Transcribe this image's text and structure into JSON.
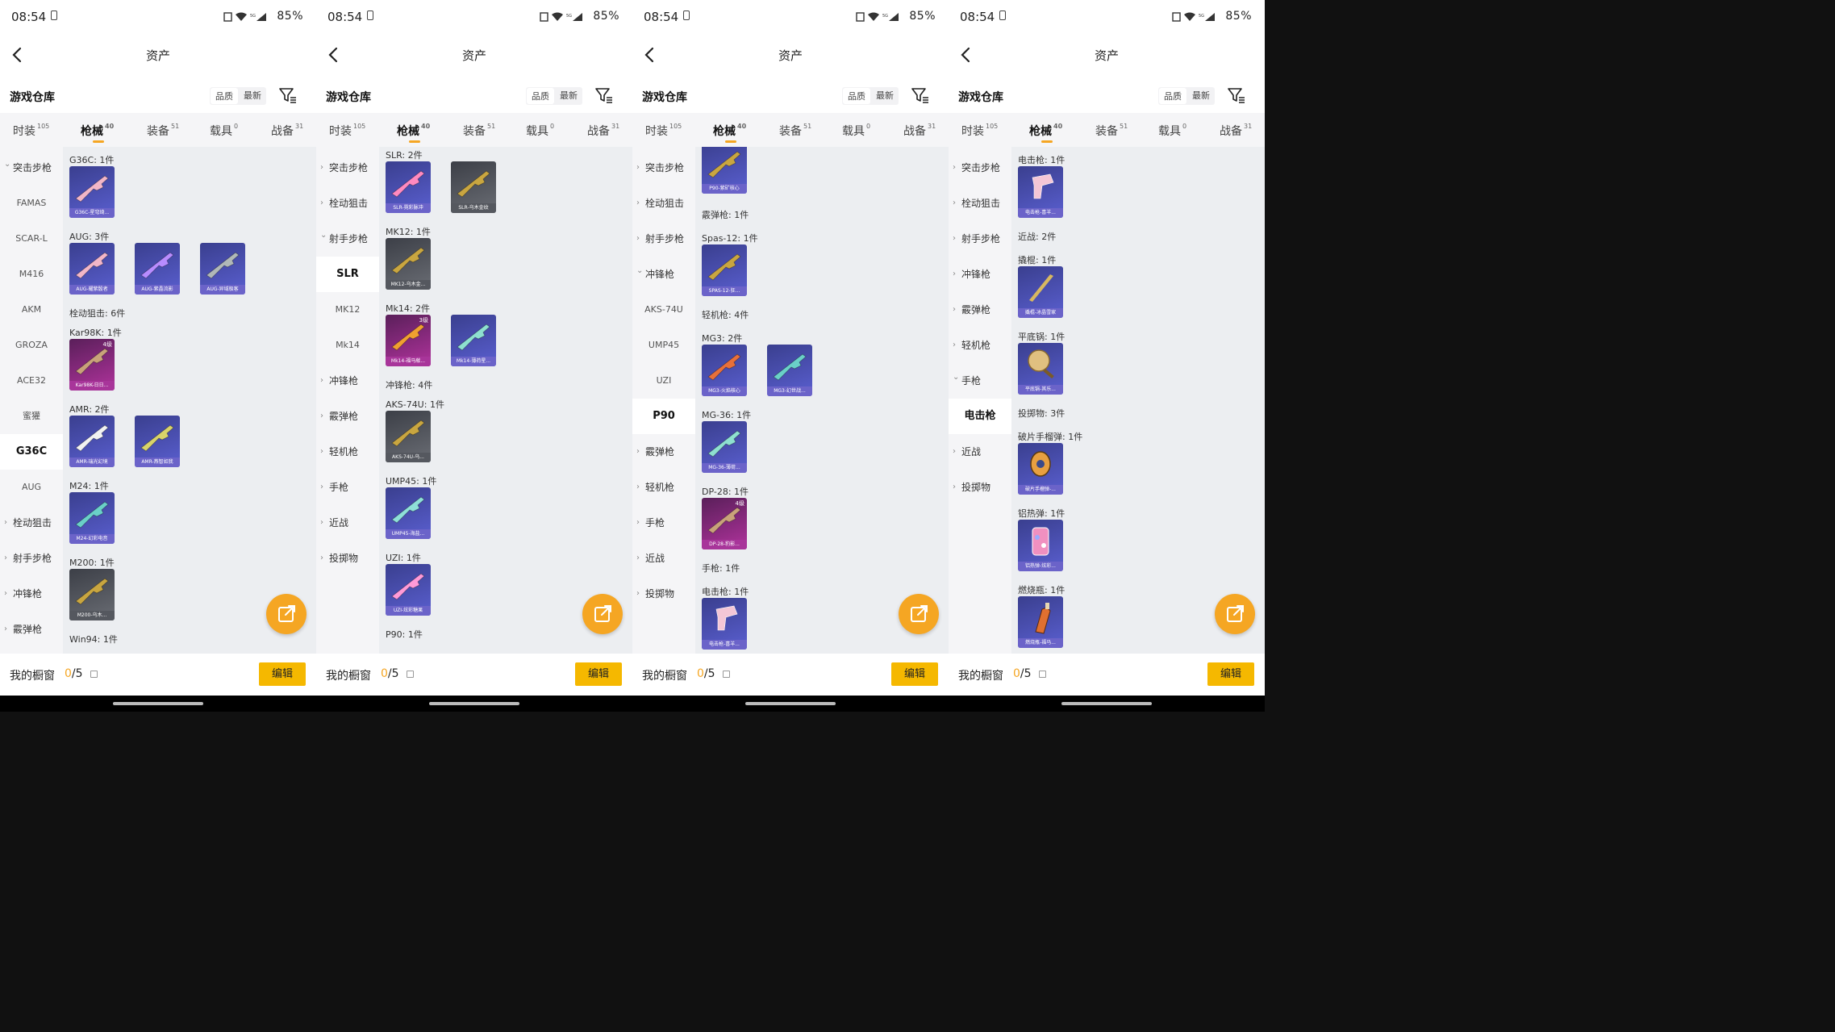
{
  "status": {
    "time": "08:54",
    "battery": "85%"
  },
  "header": {
    "title": "资产"
  },
  "warehouse": {
    "title": "游戏仓库",
    "sort_quality": "品质",
    "sort_latest": "最新"
  },
  "tabs": [
    {
      "label": "时装",
      "count": "105"
    },
    {
      "label": "枪械",
      "count": "40"
    },
    {
      "label": "装备",
      "count": "51"
    },
    {
      "label": "载具",
      "count": "0"
    },
    {
      "label": "战备",
      "count": "31"
    }
  ],
  "footer": {
    "label": "我的橱窗",
    "count_current": "0",
    "count_total": "/5",
    "edit": "编辑"
  },
  "colors": {
    "accent": "#f5a623",
    "edit_button": "#f5b800"
  },
  "panels": [
    {
      "sidebar": [
        {
          "label": "突击步枪",
          "type": "cat",
          "expanded": true
        },
        {
          "label": "FAMAS",
          "type": "sub"
        },
        {
          "label": "SCAR-L",
          "type": "sub"
        },
        {
          "label": "M416",
          "type": "sub"
        },
        {
          "label": "AKM",
          "type": "sub"
        },
        {
          "label": "GROZA",
          "type": "sub"
        },
        {
          "label": "ACE32",
          "type": "sub"
        },
        {
          "label": "蜜獾",
          "type": "sub"
        },
        {
          "label": "G36C",
          "type": "sub",
          "selected": true
        },
        {
          "label": "AUG",
          "type": "sub"
        },
        {
          "label": "栓动狙击",
          "type": "cat"
        },
        {
          "label": "射手步枪",
          "type": "cat"
        },
        {
          "label": "冲锋枪",
          "type": "cat"
        },
        {
          "label": "霰弹枪",
          "type": "cat"
        }
      ],
      "rows": [
        {
          "label": "G36C: 1件",
          "cards": [
            {
              "cap": "G36C-星穹绮...",
              "tone": "purple",
              "icon": "rifle-pink"
            }
          ]
        },
        {
          "label": "AUG: 3件",
          "cards": [
            {
              "cap": "AUG-耀紫骰者",
              "tone": "purple",
              "icon": "rifle-pink"
            },
            {
              "cap": "AUG-紫晶流影",
              "tone": "purple",
              "icon": "rifle-purple"
            },
            {
              "cap": "AUG-异域极客",
              "tone": "purple",
              "icon": "rifle-grey"
            }
          ]
        },
        {
          "label": "栓动狙击: 6件",
          "cards": []
        },
        {
          "label": "Kar98K: 1件",
          "cards": [
            {
              "cap": "Kar98K-日日...",
              "tone": "pink",
              "icon": "sniper",
              "badge": "4级"
            }
          ]
        },
        {
          "label": "AMR: 2件",
          "cards": [
            {
              "cap": "AMR-瑞光幻境",
              "tone": "purple",
              "icon": "sniper-white"
            },
            {
              "cap": "AMR-燕智如我",
              "tone": "purple",
              "icon": "sniper-yellow"
            }
          ]
        },
        {
          "label": "M24: 1件",
          "cards": [
            {
              "cap": "M24-幻彩电音",
              "tone": "purple",
              "icon": "sniper-teal"
            }
          ]
        },
        {
          "label": "M200: 1件",
          "cards": [
            {
              "cap": "M200-乌木...",
              "tone": "grey",
              "icon": "sniper-gold"
            }
          ]
        },
        {
          "label": "Win94: 1件",
          "cards": []
        }
      ]
    },
    {
      "sidebar": [
        {
          "label": "突击步枪",
          "type": "cat"
        },
        {
          "label": "栓动狙击",
          "type": "cat"
        },
        {
          "label": "射手步枪",
          "type": "cat",
          "expanded": true
        },
        {
          "label": "SLR",
          "type": "sub",
          "selected": true
        },
        {
          "label": "MK12",
          "type": "sub"
        },
        {
          "label": "Mk14",
          "type": "sub"
        },
        {
          "label": "冲锋枪",
          "type": "cat"
        },
        {
          "label": "霰弹枪",
          "type": "cat"
        },
        {
          "label": "轻机枪",
          "type": "cat"
        },
        {
          "label": "手枪",
          "type": "cat"
        },
        {
          "label": "近战",
          "type": "cat"
        },
        {
          "label": "投掷物",
          "type": "cat"
        }
      ],
      "rows": [
        {
          "label": "SLR: 2件",
          "cards": [
            {
              "cap": "SLR-霓彩脉冲",
              "tone": "purple",
              "icon": "sniper-pink"
            },
            {
              "cap": "SLR-乌木金纹",
              "tone": "grey",
              "icon": "sniper-gold"
            }
          ]
        },
        {
          "label": "MK12: 1件",
          "cards": [
            {
              "cap": "MK12-乌木金...",
              "tone": "grey",
              "icon": "sniper-gold"
            }
          ]
        },
        {
          "label": "Mk14: 2件",
          "cards": [
            {
              "cap": "Mk14-福马献...",
              "tone": "pink",
              "icon": "rifle-orange",
              "badge": "3级"
            },
            {
              "cap": "Mk14-薄荷星...",
              "tone": "purple",
              "icon": "rifle-teal"
            }
          ]
        },
        {
          "label": "冲锋枪: 4件",
          "cards": []
        },
        {
          "label": "AKS-74U: 1件",
          "cards": [
            {
              "cap": "AKS-74U-乌...",
              "tone": "grey",
              "icon": "smg-gold"
            }
          ]
        },
        {
          "label": "UMP45: 1件",
          "cards": [
            {
              "cap": "UMP45-海盐...",
              "tone": "purple",
              "icon": "smg-teal"
            }
          ]
        },
        {
          "label": "UZI: 1件",
          "cards": [
            {
              "cap": "UZI-炫彩糖果",
              "tone": "purple",
              "icon": "smg-pink"
            }
          ]
        },
        {
          "label": "P90: 1件",
          "cards": []
        }
      ]
    },
    {
      "sidebar": [
        {
          "label": "突击步枪",
          "type": "cat"
        },
        {
          "label": "栓动狙击",
          "type": "cat"
        },
        {
          "label": "射手步枪",
          "type": "cat"
        },
        {
          "label": "冲锋枪",
          "type": "cat",
          "expanded": true
        },
        {
          "label": "AKS-74U",
          "type": "sub"
        },
        {
          "label": "UMP45",
          "type": "sub"
        },
        {
          "label": "UZI",
          "type": "sub"
        },
        {
          "label": "P90",
          "type": "sub",
          "selected": true
        },
        {
          "label": "霰弹枪",
          "type": "cat"
        },
        {
          "label": "轻机枪",
          "type": "cat"
        },
        {
          "label": "手枪",
          "type": "cat"
        },
        {
          "label": "近战",
          "type": "cat"
        },
        {
          "label": "投掷物",
          "type": "cat"
        }
      ],
      "rows": [
        {
          "label": "",
          "cards": [
            {
              "cap": "P90-紫矿核心",
              "tone": "purple",
              "icon": "smg-gold"
            }
          ]
        },
        {
          "label": "霰弹枪: 1件",
          "cards": []
        },
        {
          "label": "Spas-12: 1件",
          "cards": [
            {
              "cap": "SPAS-12-狂...",
              "tone": "purple",
              "icon": "sniper-gold"
            }
          ]
        },
        {
          "label": "轻机枪: 4件",
          "cards": []
        },
        {
          "label": "MG3: 2件",
          "cards": [
            {
              "cap": "MG3-火焰核心",
              "tone": "purple",
              "icon": "sniper-orange"
            },
            {
              "cap": "MG3-幻世战...",
              "tone": "purple",
              "icon": "sniper-teal"
            }
          ]
        },
        {
          "label": "MG-36: 1件",
          "cards": [
            {
              "cap": "MG-36-薄荷...",
              "tone": "purple",
              "icon": "rifle-teal"
            }
          ]
        },
        {
          "label": "DP-28: 1件",
          "cards": [
            {
              "cap": "DP-28-豹影...",
              "tone": "pink",
              "icon": "sniper",
              "badge": "4级"
            }
          ]
        },
        {
          "label": "手枪: 1件",
          "cards": []
        },
        {
          "label": "电击枪: 1件",
          "cards": [
            {
              "cap": "电击枪-喜羊...",
              "tone": "purple",
              "icon": "taser"
            }
          ]
        }
      ]
    },
    {
      "sidebar": [
        {
          "label": "突击步枪",
          "type": "cat"
        },
        {
          "label": "栓动狙击",
          "type": "cat"
        },
        {
          "label": "射手步枪",
          "type": "cat"
        },
        {
          "label": "冲锋枪",
          "type": "cat"
        },
        {
          "label": "霰弹枪",
          "type": "cat"
        },
        {
          "label": "轻机枪",
          "type": "cat"
        },
        {
          "label": "手枪",
          "type": "cat",
          "expanded": true
        },
        {
          "label": "电击枪",
          "type": "sub",
          "selected": true
        },
        {
          "label": "近战",
          "type": "cat"
        },
        {
          "label": "投掷物",
          "type": "cat"
        }
      ],
      "rows": [
        {
          "label": "电击枪: 1件",
          "cards": [
            {
              "cap": "电击枪-喜羊...",
              "tone": "purple",
              "icon": "taser"
            }
          ]
        },
        {
          "label": "近战: 2件",
          "cards": []
        },
        {
          "label": "撬棍: 1件",
          "cards": [
            {
              "cap": "撬棍-冰晶雪家",
              "tone": "purple",
              "icon": "crowbar"
            }
          ]
        },
        {
          "label": "平底锅: 1件",
          "cards": [
            {
              "cap": "平底锅-其乐...",
              "tone": "purple",
              "icon": "pan"
            }
          ]
        },
        {
          "label": "投掷物: 3件",
          "cards": []
        },
        {
          "label": "破片手榴弹: 1件",
          "cards": [
            {
              "cap": "破片手榴弹-...",
              "tone": "purple",
              "icon": "grenade"
            }
          ]
        },
        {
          "label": "铝热弹: 1件",
          "cards": [
            {
              "cap": "铝热弹-炫彩...",
              "tone": "purple",
              "icon": "thermite"
            }
          ]
        },
        {
          "label": "燃烧瓶: 1件",
          "cards": [
            {
              "cap": "燃烧瓶-福马...",
              "tone": "purple",
              "icon": "molotov"
            }
          ]
        }
      ]
    }
  ]
}
